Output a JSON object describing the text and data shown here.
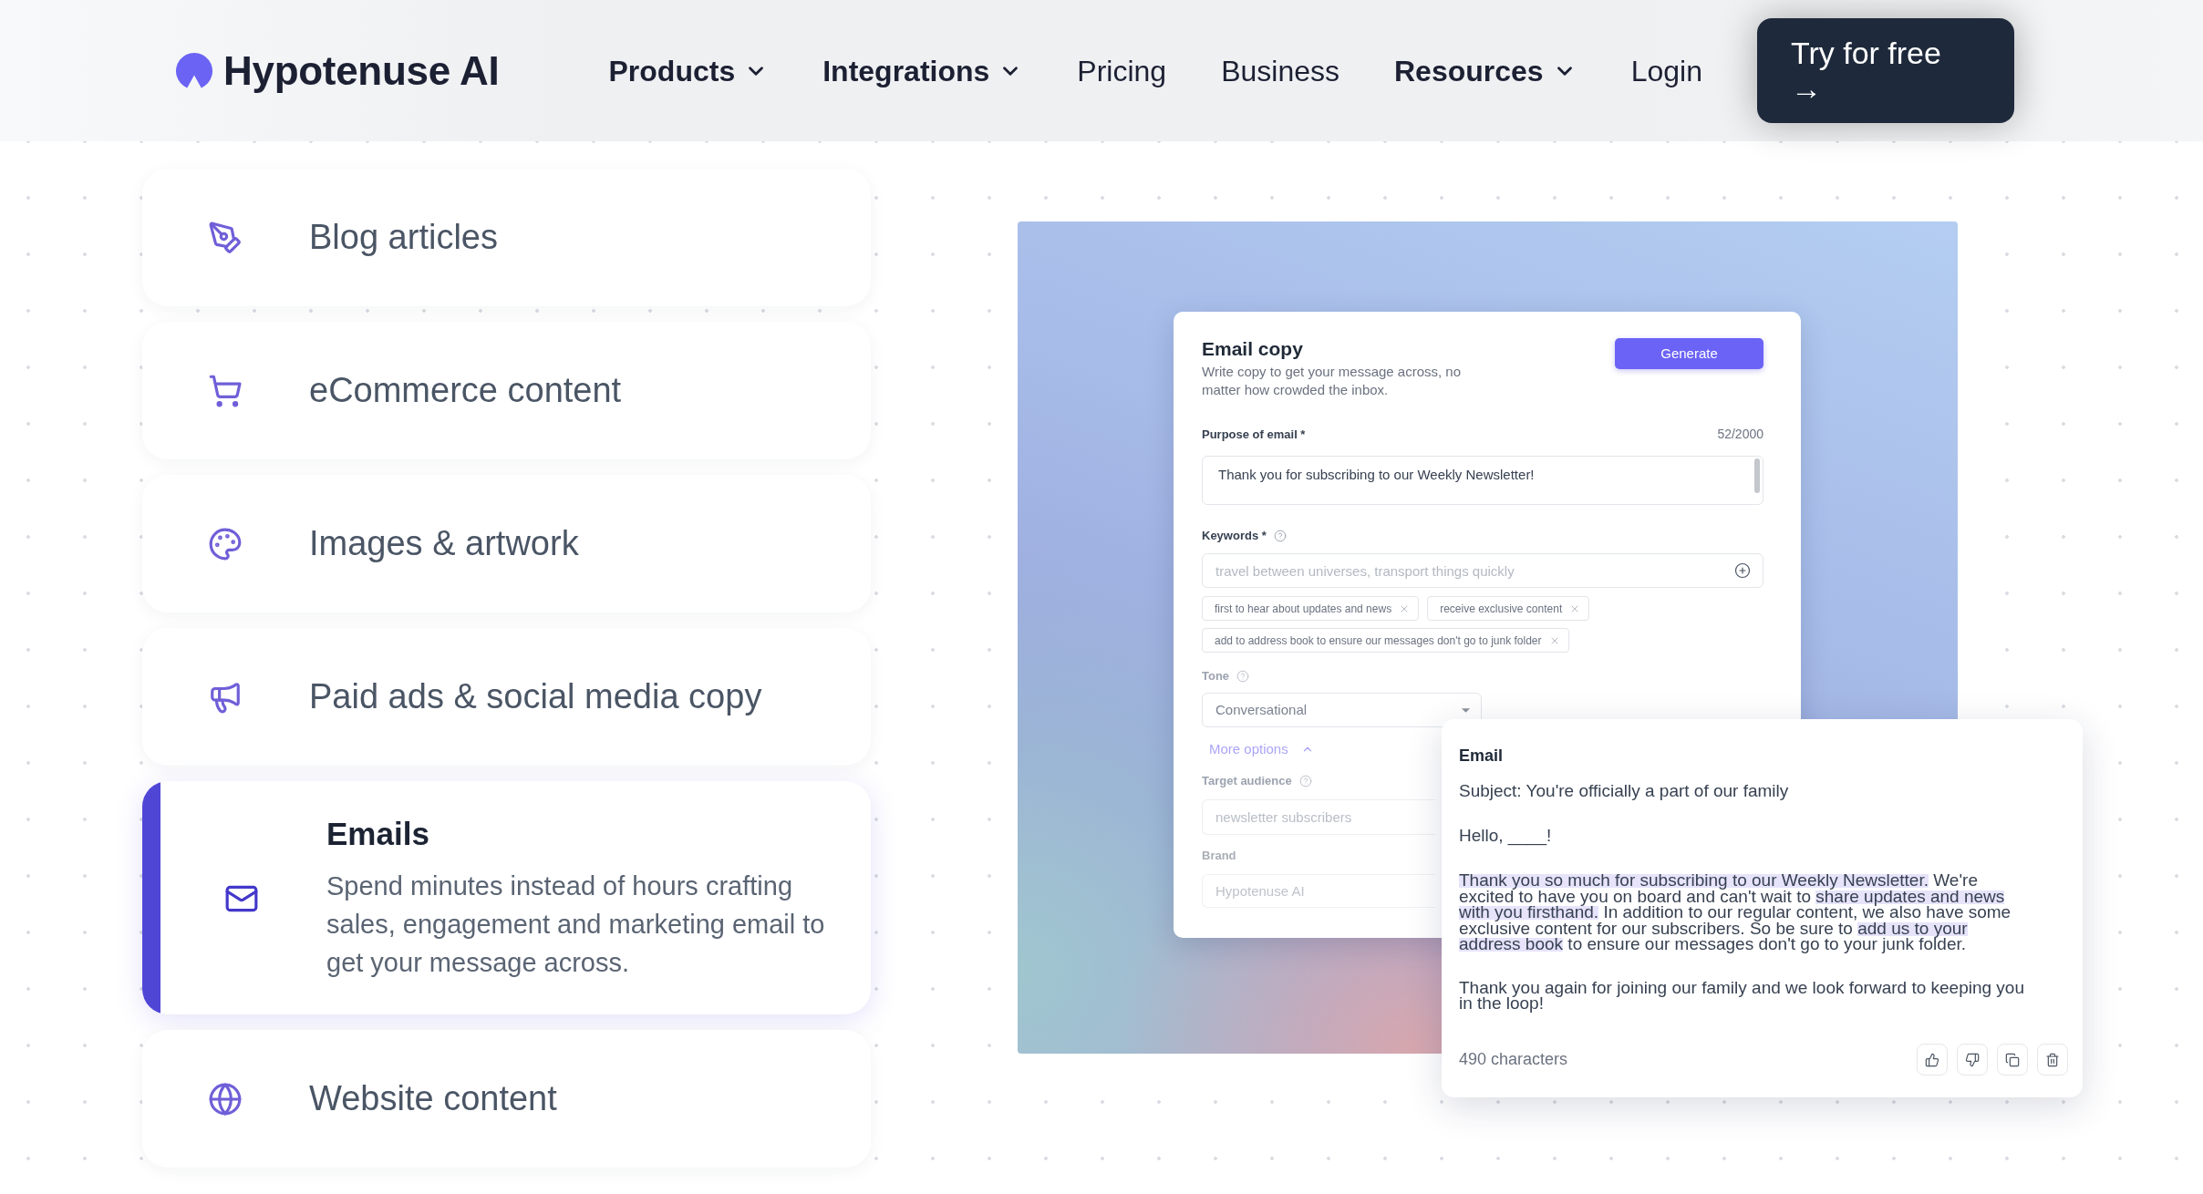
{
  "header": {
    "logo_text": "Hypotenuse AI",
    "nav": [
      {
        "label": "Products",
        "dropdown": true
      },
      {
        "label": "Integrations",
        "dropdown": true
      },
      {
        "label": "Pricing",
        "dropdown": false
      },
      {
        "label": "Business",
        "dropdown": false
      },
      {
        "label": "Resources",
        "dropdown": true
      },
      {
        "label": "Login",
        "dropdown": false
      }
    ],
    "cta": {
      "label": "Try for free",
      "arrow": "→"
    }
  },
  "use_cases": [
    {
      "title": "Blog articles",
      "selected": false
    },
    {
      "title": "eCommerce content",
      "selected": false
    },
    {
      "title": "Images & artwork",
      "selected": false
    },
    {
      "title": "Paid ads & social media copy",
      "selected": false
    },
    {
      "title": "Emails",
      "selected": true,
      "description": "Spend minutes instead of hours crafting sales, engagement and marketing email to get your message across."
    },
    {
      "title": "Website content",
      "selected": false
    }
  ],
  "email_copy_form": {
    "title": "Email copy",
    "subtitle": "Write copy to get your message across, no matter how crowded the inbox.",
    "generate_button": "Generate",
    "purpose": {
      "label": "Purpose of email *",
      "counter": "52/2000",
      "value": "Thank you for subscribing to our Weekly Newsletter!",
      "help": false
    },
    "keywords": {
      "label": "Keywords *",
      "placeholder": "travel between universes, transport things quickly",
      "help": true,
      "tags": [
        "first to hear about updates and news",
        "receive exclusive content",
        "add to address book to ensure our messages don't go to junk folder"
      ]
    },
    "tone": {
      "label": "Tone",
      "value": "Conversational",
      "help": true
    },
    "more_options": {
      "label": "More options",
      "expanded": true
    },
    "target_audience": {
      "label": "Target audience",
      "placeholder": "newsletter subscribers",
      "help": true
    },
    "brand": {
      "label": "Brand",
      "placeholder": "Hypotenuse AI",
      "help": false
    }
  },
  "generated_email": {
    "title": "Email",
    "subject": "Subject: You're officially a part of our family",
    "greeting": "Hello, ____!",
    "body": [
      {
        "text": "Thank you so much for subscribing to our Weekly Newsletter.",
        "highlighted": true
      },
      {
        "text": " We're excited to have you on board and can't wait to ",
        "highlighted": false
      },
      {
        "text": "share updates and news with you firsthand.",
        "highlighted": true
      },
      {
        "text": " In addition to our regular content, we also have some exclusive content for our subscribers. So be sure to ",
        "highlighted": false
      },
      {
        "text": "add us to your address book",
        "highlighted": true
      },
      {
        "text": " to ensure our messages don't go to your junk folder.",
        "highlighted": false
      }
    ],
    "closing": "Thank you again for joining our family and we look forward to keeping you in the loop!",
    "count": "490 characters"
  }
}
